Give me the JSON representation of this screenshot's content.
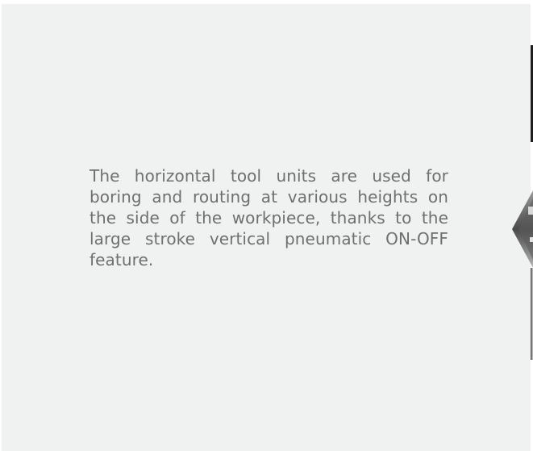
{
  "content": {
    "description": "The horizontal tool units are used for boring and routing at various heights on the side of the workpiece, thanks to the large stroke vertical pneumatic ON-OFF feature."
  },
  "colors": {
    "panel_background": "#f0f1f1",
    "text": "#6f6f6f"
  }
}
